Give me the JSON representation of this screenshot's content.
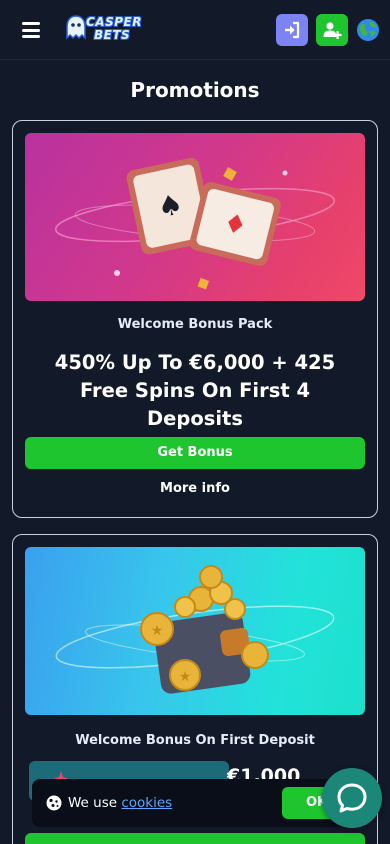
{
  "header": {
    "logo_line1": "CASPER",
    "logo_line2": "BETS",
    "icons": [
      "menu-icon",
      "login-icon",
      "add-user-icon",
      "globe-icon"
    ]
  },
  "page": {
    "title": "Promotions"
  },
  "promos": [
    {
      "subtitle": "Welcome Bonus Pack",
      "title": "450% Up To €6,000 + 425 Free Spins On First 4 Deposits",
      "button": "Get Bonus",
      "more": "More info"
    },
    {
      "subtitle": "Welcome Bonus On First Deposit",
      "amount_partial": "€1,000"
    }
  ],
  "cookie": {
    "text": "We use",
    "link": "cookies",
    "button": "OK"
  },
  "colors": {
    "background": "#121a29",
    "green": "#1fc52f",
    "login_button": "#7b83f5",
    "chat": "#1a8778",
    "link": "#5aa8ff"
  }
}
